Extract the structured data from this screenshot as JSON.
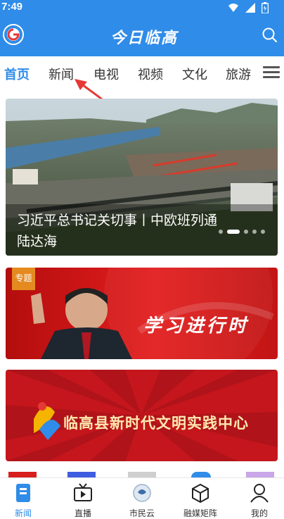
{
  "status": {
    "time": "7:49"
  },
  "app": {
    "title": "今日临高"
  },
  "tabs": [
    {
      "label": "首页"
    },
    {
      "label": "新闻"
    },
    {
      "label": "电视"
    },
    {
      "label": "视频"
    },
    {
      "label": "文化"
    },
    {
      "label": "旅游"
    }
  ],
  "banner": {
    "caption": "习近平总书记关切事丨中欧班列通陆达海",
    "slide_count": 5,
    "active_slide": 2
  },
  "card1": {
    "tag": "专题",
    "slogan": "学习进行时"
  },
  "card2": {
    "title": "临高县新时代文明实践中心"
  },
  "bottom_nav": [
    {
      "label": "新闻",
      "icon": "news-icon"
    },
    {
      "label": "直播",
      "icon": "live-tv-icon"
    },
    {
      "label": "市民云",
      "icon": "citizen-cloud-icon"
    },
    {
      "label": "融媒矩阵",
      "icon": "cube-icon"
    },
    {
      "label": "我的",
      "icon": "profile-icon"
    }
  ],
  "colors": {
    "primary": "#2f8ce8",
    "banner_red": "#c4161c",
    "tag_orange": "#e58a1f"
  }
}
